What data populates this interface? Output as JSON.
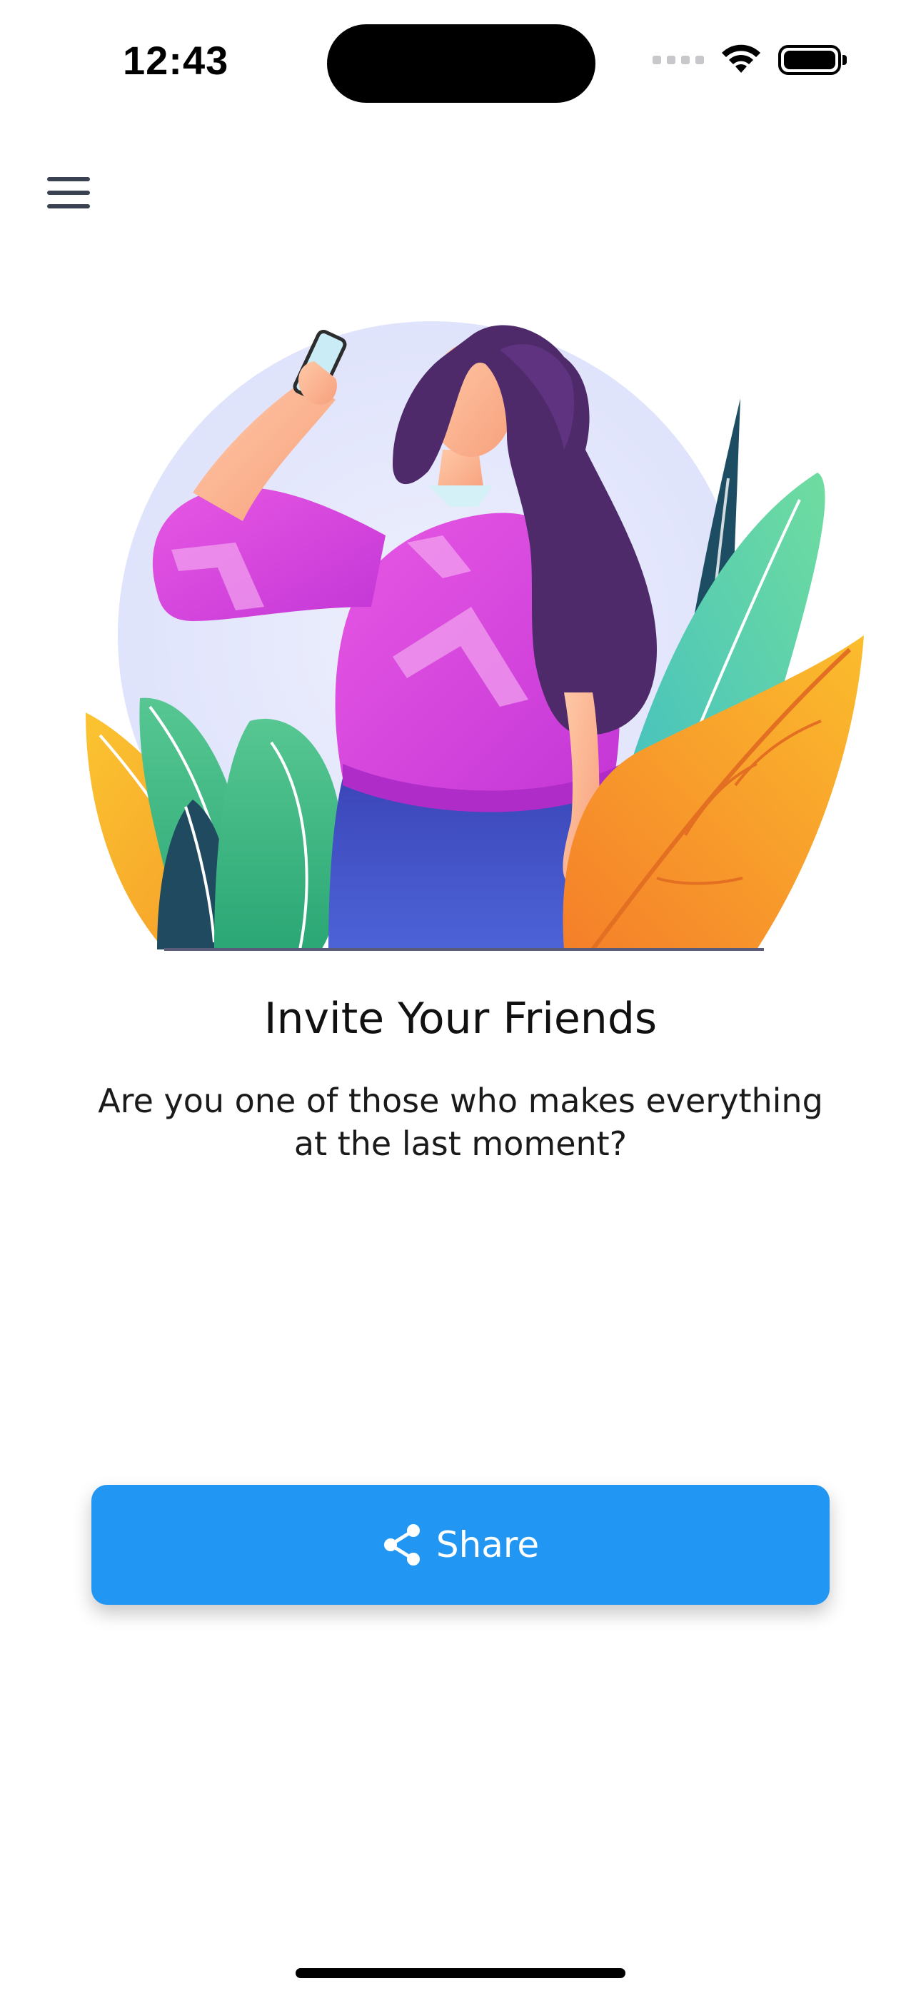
{
  "status_bar": {
    "time": "12:43",
    "icons": [
      "signal-icon",
      "wifi-icon",
      "battery-icon"
    ]
  },
  "nav": {
    "menu_icon": "hamburger-menu-icon"
  },
  "content": {
    "title": "Invite Your Friends",
    "subtitle": "Are you one of those who makes everything at the last moment?"
  },
  "share_button": {
    "label": "Share",
    "icon": "share-icon",
    "color": "#2196f3"
  },
  "colors": {
    "primary": "#2196f3",
    "text": "#111111",
    "background": "#ffffff"
  }
}
